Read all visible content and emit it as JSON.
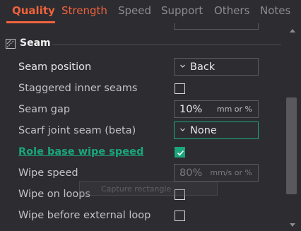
{
  "tabs": [
    {
      "label": "Quality"
    },
    {
      "label": "Strength"
    },
    {
      "label": "Speed"
    },
    {
      "label": "Support"
    },
    {
      "label": "Others"
    },
    {
      "label": "Notes"
    }
  ],
  "section": {
    "title": "Seam",
    "icon": "seam-icon"
  },
  "settings": {
    "seam_position": {
      "label": "Seam position",
      "value": "Back"
    },
    "staggered": {
      "label": "Staggered inner seams",
      "checked": false
    },
    "seam_gap": {
      "label": "Seam gap",
      "value": "10%",
      "unit": "mm or %"
    },
    "scarf": {
      "label": "Scarf joint seam (beta)",
      "value": "None"
    },
    "role_wipe": {
      "label": "Role base wipe speed",
      "checked": true
    },
    "wipe_speed": {
      "label": "Wipe speed",
      "value": "80%",
      "unit": "mm/s or %"
    },
    "wipe_loops": {
      "label": "Wipe on loops",
      "checked": false
    },
    "wipe_before": {
      "label": "Wipe before external loop",
      "checked": false
    }
  },
  "tooltip": {
    "text": "Capture rectangle"
  },
  "colors": {
    "accent": "#f0623c",
    "green": "#1aa67a",
    "background": "#2d2d31"
  }
}
